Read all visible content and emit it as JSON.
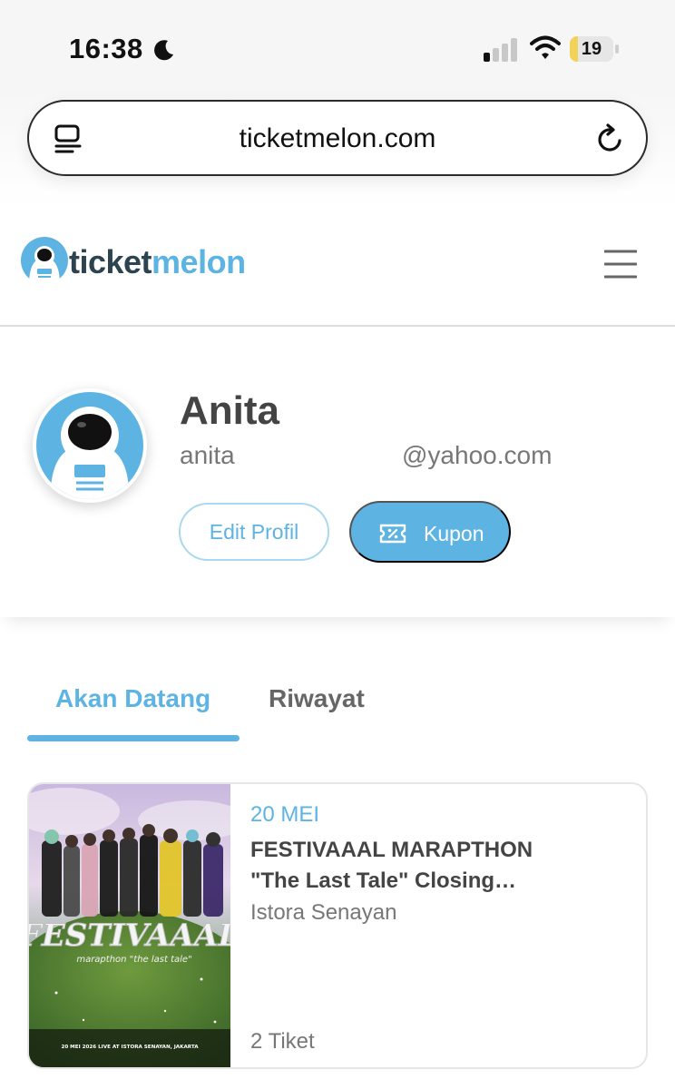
{
  "status_bar": {
    "time": "16:38",
    "battery": "19",
    "battery_level": 0.19,
    "battery_color": "#f3d25a"
  },
  "browser": {
    "url": "ticketmelon.com"
  },
  "site_header": {
    "logo_ticket": "ticket",
    "logo_melon": "melon",
    "brand_color": "#5db4e3"
  },
  "profile": {
    "name": "Anita",
    "username": "anita",
    "email_domain": "@yahoo.com",
    "edit_button": "Edit Profil",
    "coupon_button": "Kupon"
  },
  "tabs": [
    {
      "label": "Akan Datang",
      "active": true
    },
    {
      "label": "Riwayat",
      "active": false
    }
  ],
  "events": [
    {
      "date": "20 MEI",
      "title_line1": "FESTIVAAAL MARAPTHON",
      "title_line2": "\"The Last Tale\" Closing…",
      "venue": "Istora Senayan",
      "ticket_count": "2 Tiket",
      "poster": {
        "title": "FESTIVAAAL",
        "subtitle": "marapthon \"the last tale\"",
        "footer": "20 MEI 2026 LIVE AT ISTORA SENAYAN, JAKARTA"
      }
    }
  ]
}
